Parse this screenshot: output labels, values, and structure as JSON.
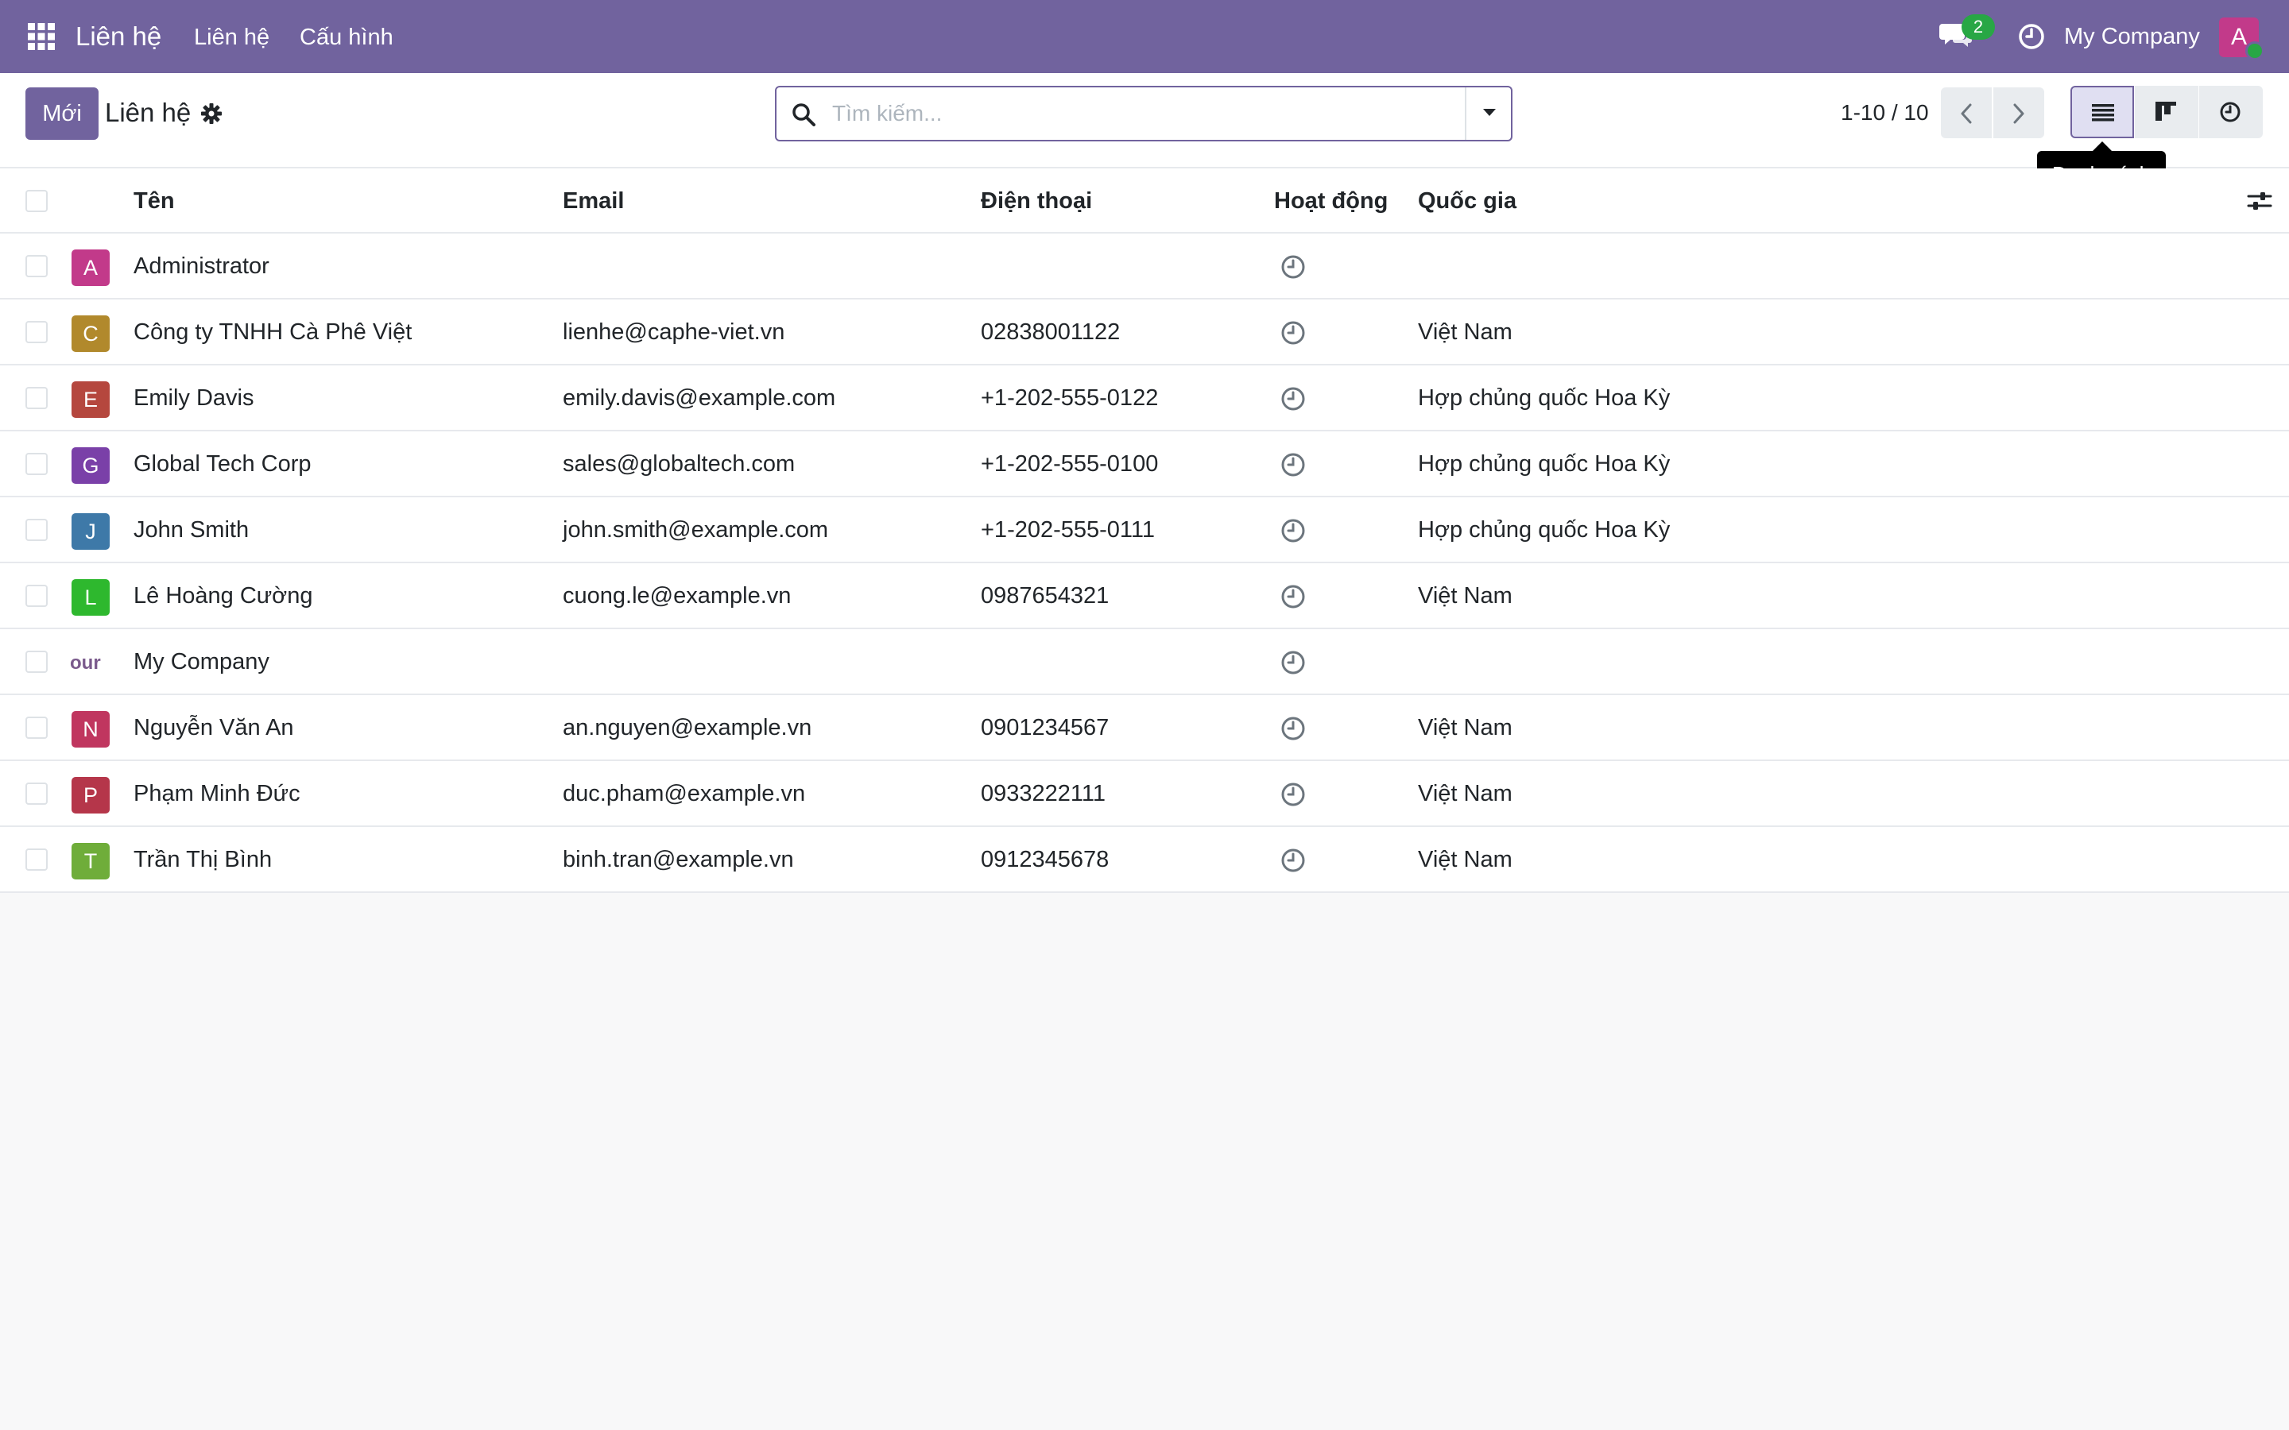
{
  "navbar": {
    "app_name": "Liên hệ",
    "menu": [
      "Liên hệ",
      "Cấu hình"
    ],
    "chat_count": "2",
    "company": "My Company",
    "user_initial": "A",
    "brand_color": "#71639e"
  },
  "control_panel": {
    "new_button": "Mới",
    "title": "Liên hệ",
    "search_placeholder": "Tìm kiếm...",
    "pager": "1-10 / 10",
    "tooltip": "Danh sách"
  },
  "table": {
    "headers": {
      "name": "Tên",
      "email": "Email",
      "phone": "Điện thoại",
      "activity": "Hoạt động",
      "country": "Quốc gia"
    },
    "rows": [
      {
        "avatar": "A",
        "color": "#c23a8a",
        "name": "Administrator",
        "email": "",
        "phone": "",
        "country": ""
      },
      {
        "avatar": "C",
        "color": "#b1892c",
        "name": "Công ty TNHH Cà Phê Việt",
        "email": "lienhe@caphe-viet.vn",
        "phone": "02838001122",
        "country": "Việt Nam"
      },
      {
        "avatar": "E",
        "color": "#b5473e",
        "name": "Emily Davis",
        "email": "emily.davis@example.com",
        "phone": "+1-202-555-0122",
        "country": "Hợp chủng quốc Hoa Kỳ"
      },
      {
        "avatar": "G",
        "color": "#7a40a8",
        "name": "Global Tech Corp",
        "email": "sales@globaltech.com",
        "phone": "+1-202-555-0100",
        "country": "Hợp chủng quốc Hoa Kỳ"
      },
      {
        "avatar": "J",
        "color": "#3e79a8",
        "name": "John Smith",
        "email": "john.smith@example.com",
        "phone": "+1-202-555-0111",
        "country": "Hợp chủng quốc Hoa Kỳ"
      },
      {
        "avatar": "L",
        "color": "#2eb82e",
        "name": "Lê Hoàng Cường",
        "email": "cuong.le@example.vn",
        "phone": "0987654321",
        "country": "Việt Nam"
      },
      {
        "avatar": "our l",
        "color": "#ffffff",
        "name": "My Company",
        "email": "",
        "phone": "",
        "country": "",
        "logo": true
      },
      {
        "avatar": "N",
        "color": "#c0365f",
        "name": "Nguyễn Văn An",
        "email": "an.nguyen@example.vn",
        "phone": "0901234567",
        "country": "Việt Nam"
      },
      {
        "avatar": "P",
        "color": "#b5364a",
        "name": "Phạm Minh Đức",
        "email": "duc.pham@example.vn",
        "phone": "0933222111",
        "country": "Việt Nam"
      },
      {
        "avatar": "T",
        "color": "#6fad3a",
        "name": "Trần Thị Bình",
        "email": "binh.tran@example.vn",
        "phone": "0912345678",
        "country": "Việt Nam"
      }
    ]
  }
}
